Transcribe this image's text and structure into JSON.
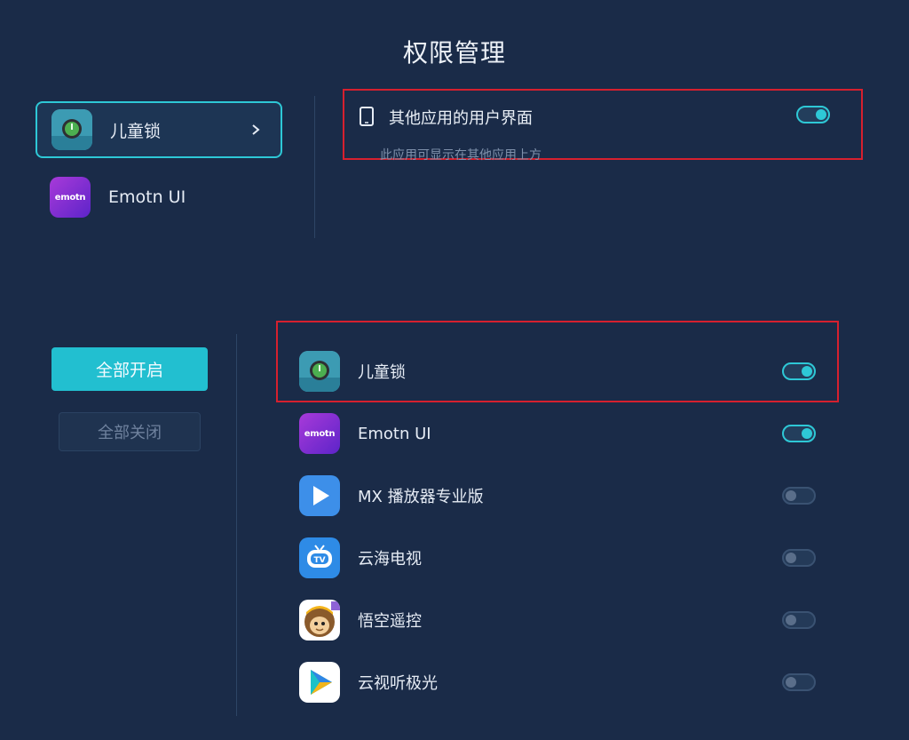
{
  "page_title": "权限管理",
  "apps_top": [
    {
      "label": "儿童锁",
      "icon": "child-lock-icon"
    },
    {
      "label": "Emotn UI",
      "icon": "emotn-icon"
    }
  ],
  "permission": {
    "icon": "tablet-icon",
    "label": "其他应用的用户界面",
    "description": "此应用可显示在其他应用上方",
    "enabled": true
  },
  "buttons": {
    "open_all": "全部开启",
    "close_all": "全部关闭"
  },
  "emotn_logo_text": "emotn",
  "app_list": [
    {
      "label": "儿童锁",
      "icon": "child-lock-icon",
      "enabled": true
    },
    {
      "label": "Emotn UI",
      "icon": "emotn-icon",
      "enabled": true
    },
    {
      "label": "MX 播放器专业版",
      "icon": "mx-player-icon",
      "enabled": false
    },
    {
      "label": "云海电视",
      "icon": "yunhai-tv-icon",
      "enabled": false
    },
    {
      "label": "悟空遥控",
      "icon": "wukong-remote-icon",
      "enabled": false
    },
    {
      "label": "云视听极光",
      "icon": "yunshiting-icon",
      "enabled": false
    }
  ],
  "colors": {
    "background": "#1a2b48",
    "accent": "#2ec8d6",
    "highlight_box": "#d6202e"
  }
}
